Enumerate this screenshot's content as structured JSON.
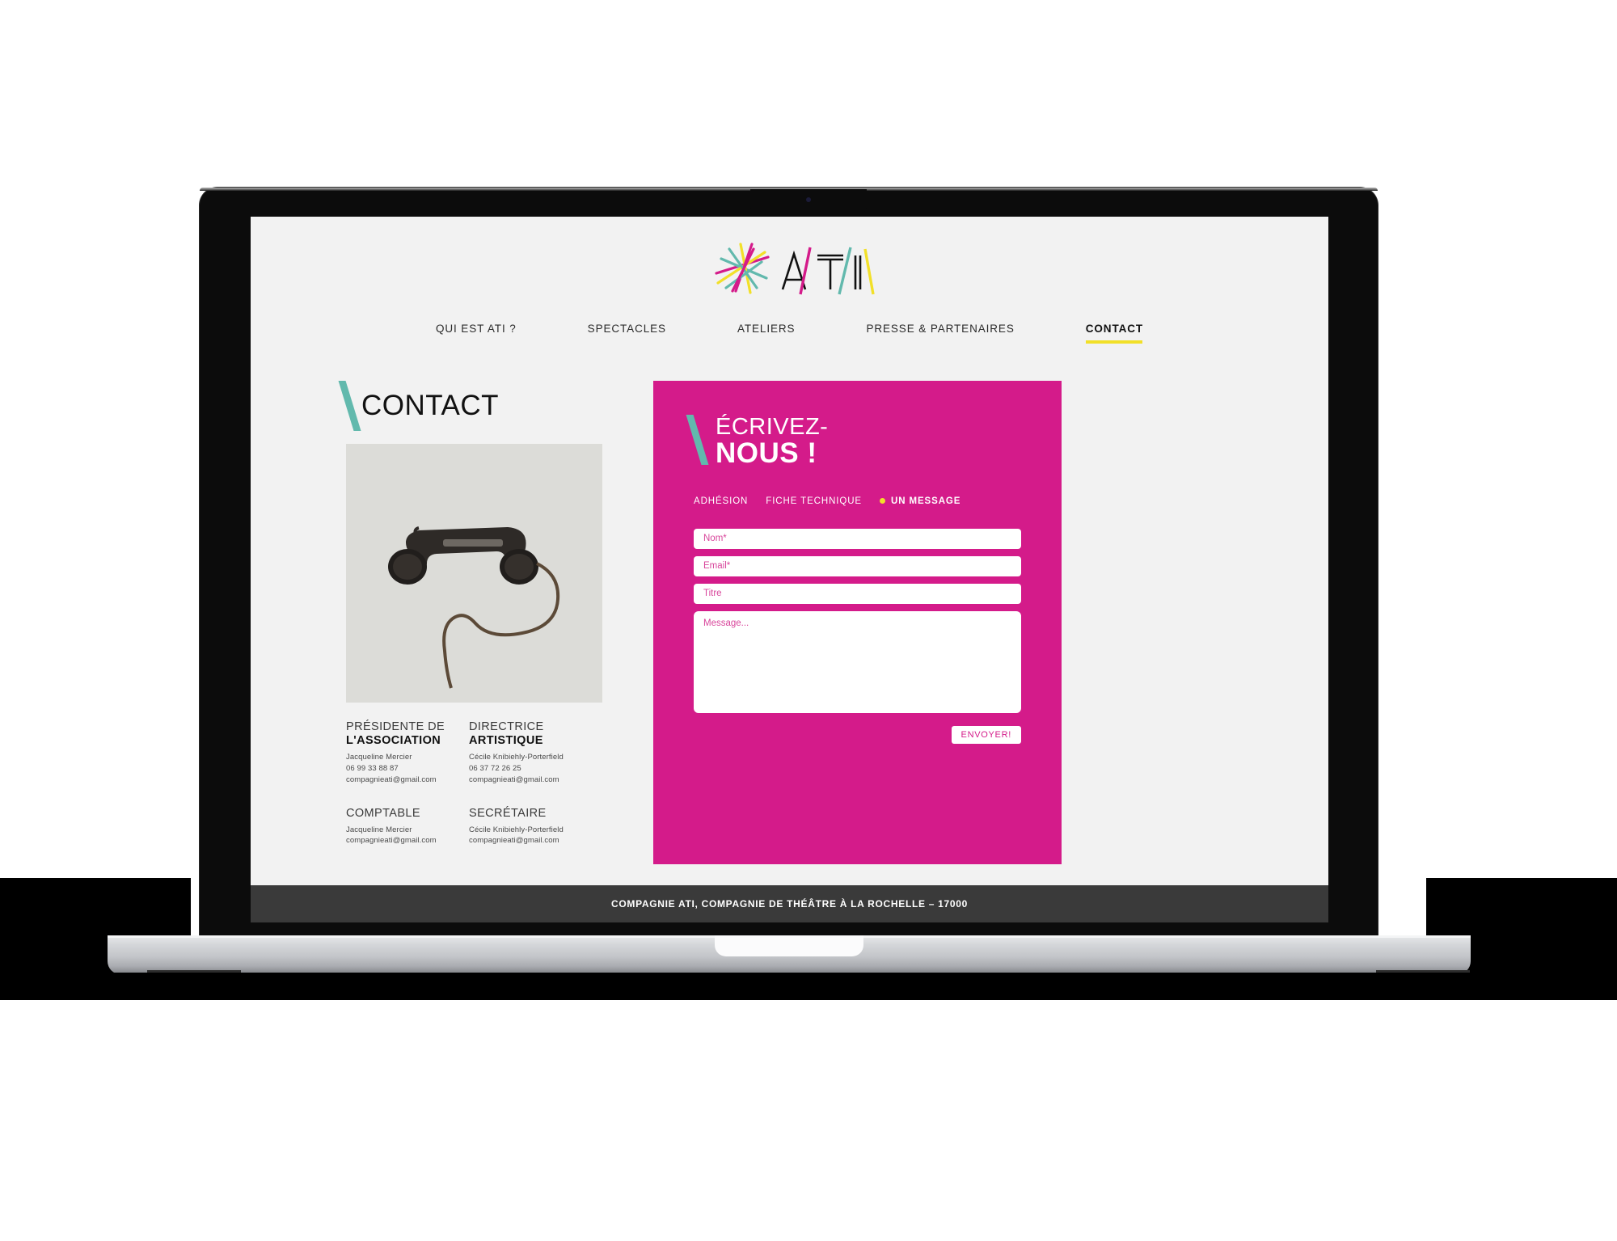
{
  "site": {
    "logo_alt": "ATI",
    "logo_wordmark": "ATI"
  },
  "nav": {
    "items": [
      {
        "label": "QUI EST ATI ?",
        "active": false
      },
      {
        "label": "SPECTACLES",
        "active": false
      },
      {
        "label": "ATELIERS",
        "active": false
      },
      {
        "label": "PRESSE & PARTENAIRES",
        "active": false
      },
      {
        "label": "CONTACT",
        "active": true
      }
    ]
  },
  "page": {
    "title": "CONTACT",
    "photo_alt": "vintage black telephone handset with cord"
  },
  "contacts": [
    {
      "role_line1": "PRÉSIDENTE DE",
      "role_line2": "L'ASSOCIATION",
      "name": "Jacqueline Mercier",
      "phone": "06 99 33 88 87",
      "email": "compagnieati@gmail.com"
    },
    {
      "role_line1": "DIRECTRICE",
      "role_line2": "ARTISTIQUE",
      "name": "Cécile Knibiehly-Porterfield",
      "phone": "06 37 72 26 25",
      "email": "compagnieati@gmail.com"
    },
    {
      "role_line1": "COMPTABLE",
      "role_line2": "",
      "name": "Jacqueline Mercier",
      "phone": "",
      "email": "compagnieati@gmail.com"
    },
    {
      "role_line1": "SECRÉTAIRE",
      "role_line2": "",
      "name": "Cécile Knibiehly-Porterfield",
      "phone": "",
      "email": "compagnieati@gmail.com"
    }
  ],
  "form": {
    "title_line1": "ÉCRIVEZ-",
    "title_line2": "NOUS !",
    "tabs": [
      {
        "label": "ADHÉSION",
        "active": false
      },
      {
        "label": "FICHE TECHNIQUE",
        "active": false
      },
      {
        "label": "UN MESSAGE",
        "active": true
      }
    ],
    "fields": {
      "name_placeholder": "Nom*",
      "name_value": "",
      "email_placeholder": "Email*",
      "email_value": "",
      "subject_placeholder": "Titre",
      "subject_value": "",
      "message_placeholder": "Message...",
      "message_value": ""
    },
    "submit_label": "ENVOYER!"
  },
  "footer": {
    "text": "COMPAGNIE ATI, COMPAGNIE DE THÉÂTRE À LA ROCHELLE – 17000"
  },
  "colors": {
    "magenta": "#d41b8a",
    "teal": "#62b9ad",
    "yellow": "#f2e029",
    "page_bg": "#f2f2f2",
    "footer_bg": "#3a3a3a"
  }
}
